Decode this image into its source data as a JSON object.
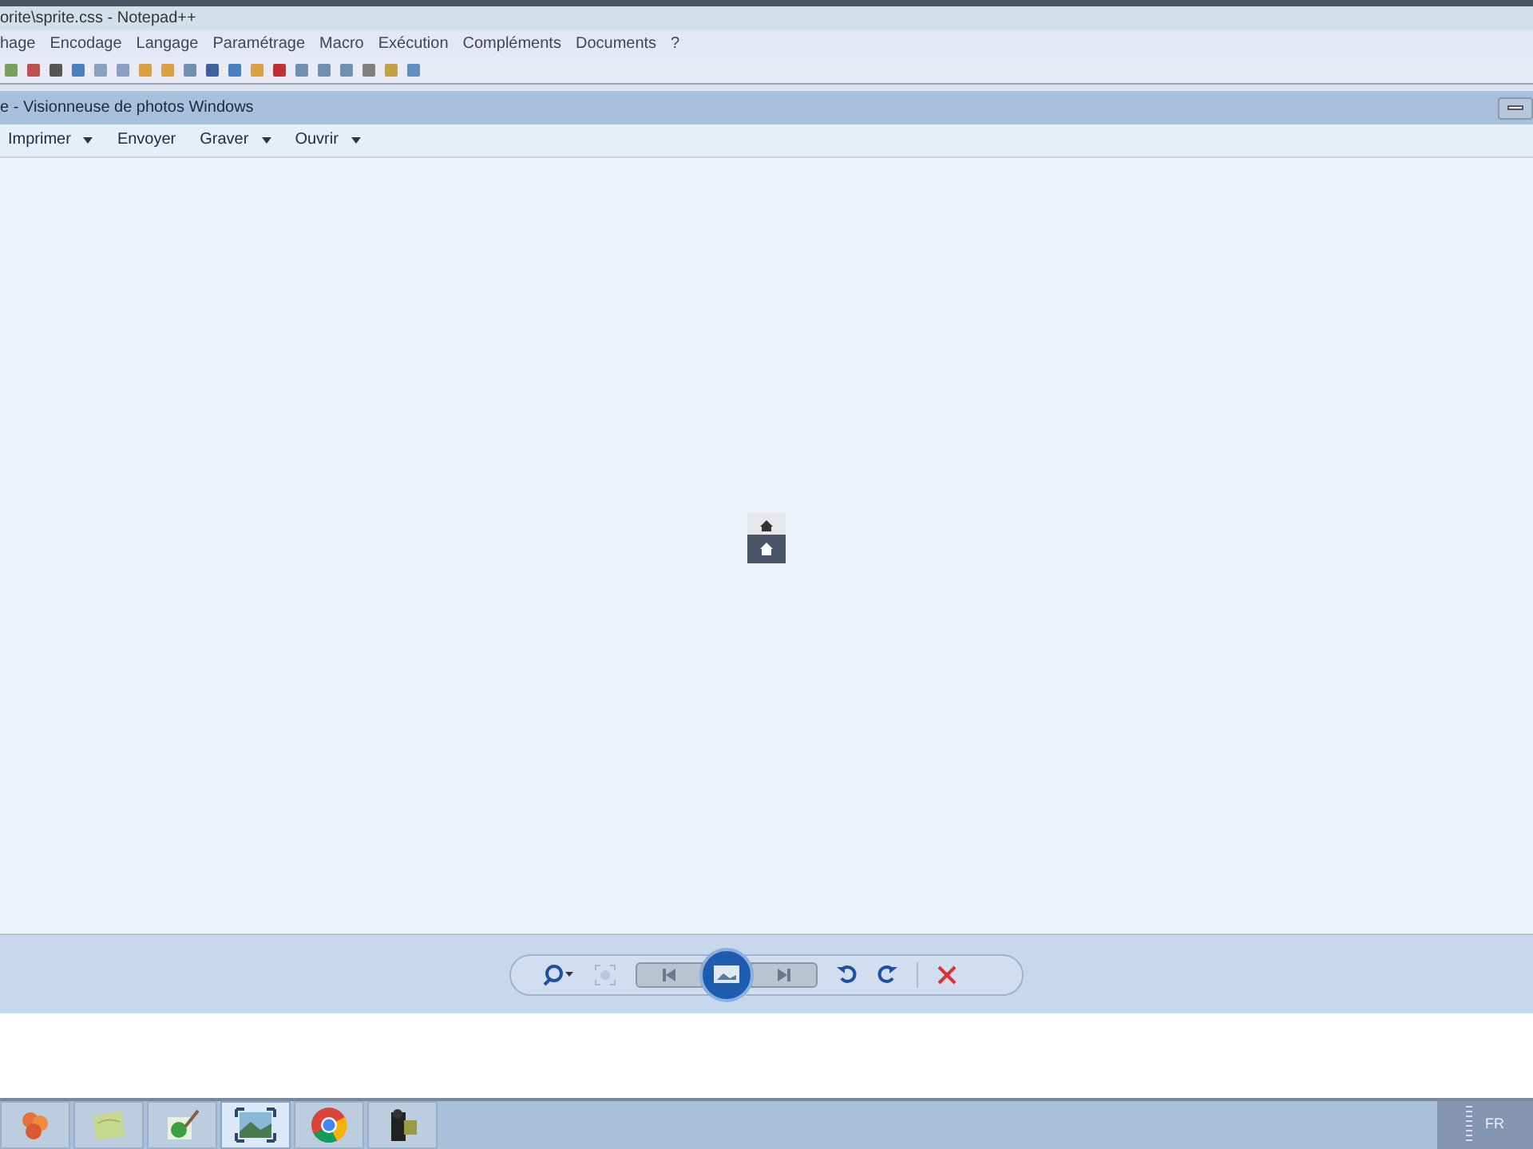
{
  "editor_window": {
    "title": "orite\\sprite.css - Notepad++",
    "menu": [
      "hage",
      "Encodage",
      "Langage",
      "Paramétrage",
      "Macro",
      "Exécution",
      "Compléments",
      "Documents",
      "?"
    ]
  },
  "viewer_window": {
    "title": "e - Visionneuse de photos Windows",
    "commands": [
      {
        "label": "Imprimer",
        "dropdown": true
      },
      {
        "label": "Envoyer",
        "dropdown": false
      },
      {
        "label": "Graver",
        "dropdown": true
      },
      {
        "label": "Ouvrir",
        "dropdown": true
      }
    ]
  },
  "taskbar": {
    "buttons": [
      {
        "selected": false
      },
      {
        "selected": false
      },
      {
        "selected": false
      },
      {
        "selected": true
      },
      {
        "selected": false
      },
      {
        "selected": false
      }
    ],
    "language": "FR"
  }
}
